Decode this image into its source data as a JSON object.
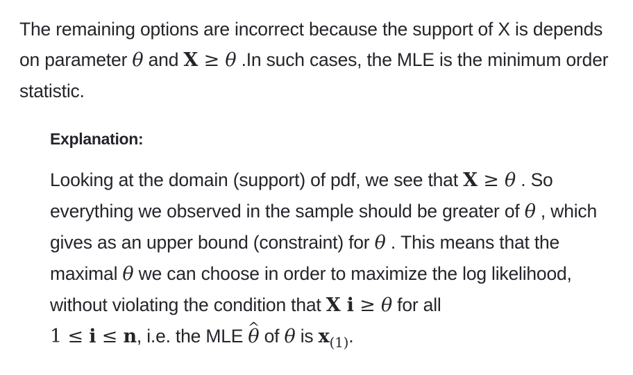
{
  "intro": {
    "t1": "The remaining options are incorrect because the support of X is depends on parameter ",
    "theta": "θ",
    "t2": " and ",
    "X": "X",
    "geq": " ≥ ",
    "t3": " .In such cases, the MLE is the minimum order statistic."
  },
  "explanation": {
    "heading": "Explanation:",
    "s1": "Looking at the domain (support) of pdf, we see that ",
    "s2": " . So everything we observed in the sample should be greater of ",
    "s3": " , which gives as an upper bound (constraint) for ",
    "s4": " . This means that the maximal ",
    "s5": " we can choose in order to maximize the log likelihood, without violating the condition that ",
    "Xi_X": "X",
    "Xi_i": " i",
    "s6": " for all",
    "one": "1",
    "leq": " ≤ ",
    "i": "i",
    "n": "n",
    "s7": ", i.e. the MLE ",
    "hat": "^",
    "s8": " of ",
    "s9": " is ",
    "x": "x",
    "sub": "(1)",
    "end": "."
  }
}
